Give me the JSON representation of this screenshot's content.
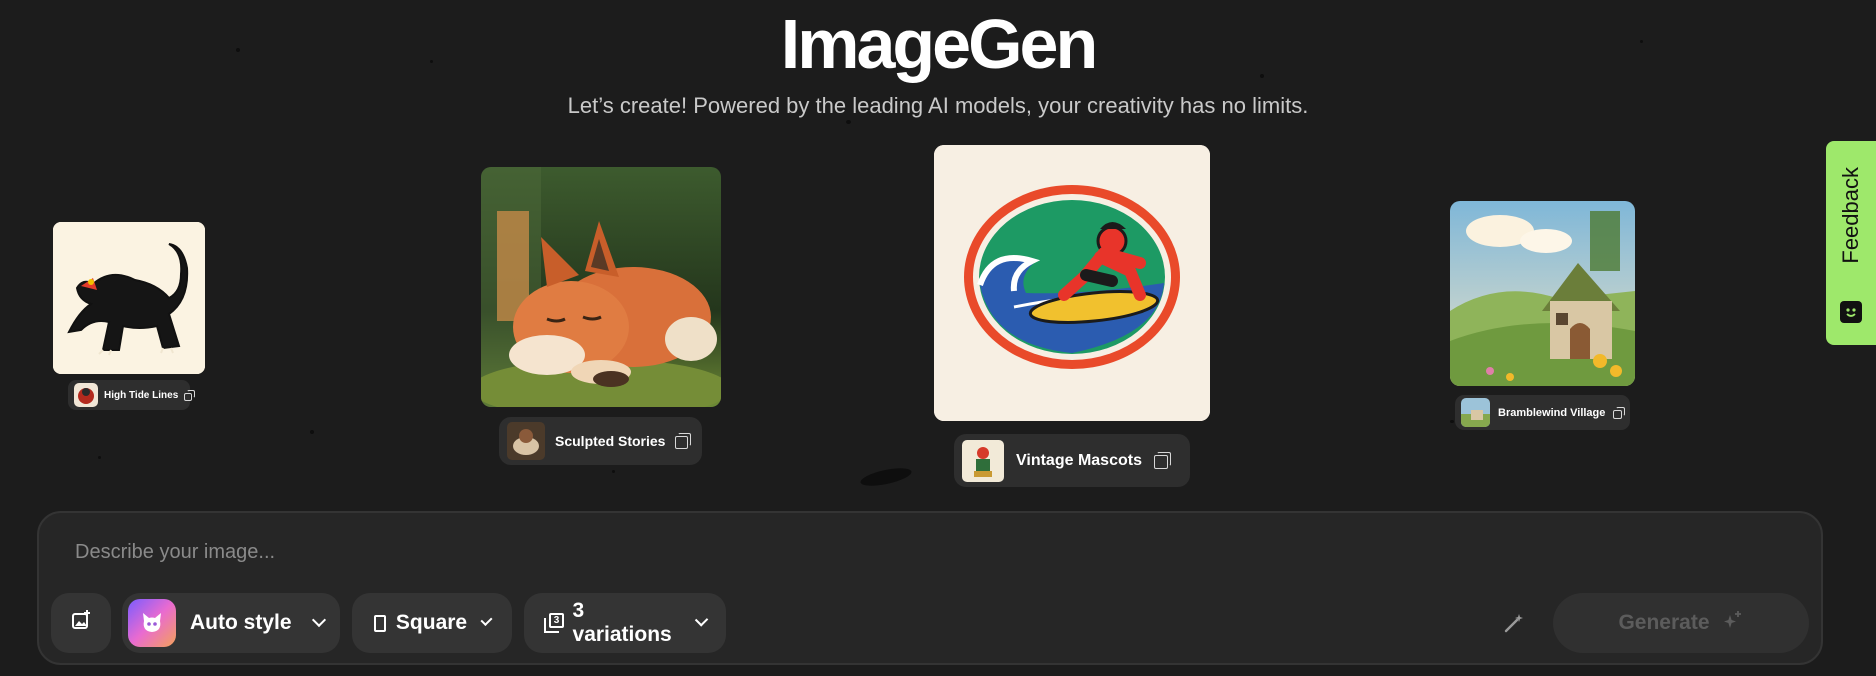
{
  "app": {
    "title": "ImageGen",
    "subtitle": "Let’s create! Powered by the leading AI models, your creativity has no limits."
  },
  "showcase": [
    {
      "label": "High Tide Lines",
      "image": "black-panther-illustration"
    },
    {
      "label": "Sculpted Stories",
      "image": "sleeping-clay-fox"
    },
    {
      "label": "Vintage Mascots",
      "image": "surfer-mascot-badge"
    },
    {
      "label": "Bramblewind Village",
      "image": "cottage-landscape"
    }
  ],
  "feedback": {
    "label": "Feedback"
  },
  "composer": {
    "placeholder": "Describe your image...",
    "style_label": "Auto style",
    "ratio_label": "Square",
    "variations_label": "3 variations",
    "variations_count": "3",
    "generate_label": "Generate"
  },
  "colors": {
    "background": "#1c1c1c",
    "feedback": "#9ee86b",
    "panel": "#262626"
  }
}
